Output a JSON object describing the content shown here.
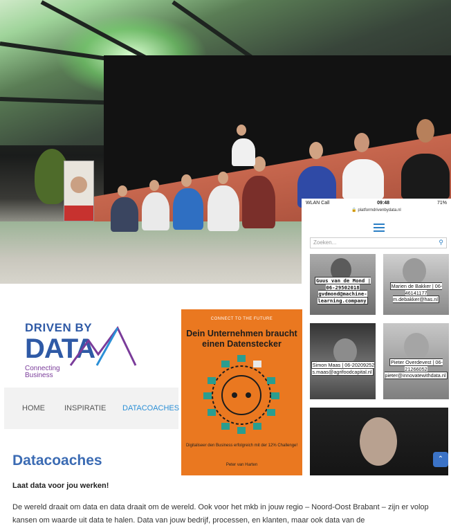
{
  "phone": {
    "carrier": "WLAN Call",
    "time": "09:48",
    "battery": "71%",
    "url": "platformdrivenbydata.nl",
    "search_placeholder": "Zoeken...",
    "coaches": [
      {
        "caption": "Guus van de Mond | 06-29502018 gvdmond@machine-learning.company"
      },
      {
        "caption": "Marien de Bakker | 06-46141177 m.debakker@has.nl"
      },
      {
        "caption": "Simon Maas | 06-20209252 s.maas@agrifoodcapital.nl"
      },
      {
        "caption": "Pieter Overdevest | 06-21266052 pieter@innovatewithdata.nl"
      }
    ]
  },
  "logo": {
    "line1": "DRIVEN BY",
    "line2": "DATA",
    "line3a": "Connecting",
    "line3b": "Business"
  },
  "nav": {
    "home": "HOME",
    "inspiratie": "INSPIRATIE",
    "datacoaches": "DATACOACHES"
  },
  "book": {
    "kicker": "CONNECT TO THE FUTURE",
    "title": "Dein Unternehmen braucht einen Datenstecker",
    "tagline": "Digitaliseer den Business erfolgreich mit der 12% Challenge!",
    "author": "Peter van Harten"
  },
  "page": {
    "title": "Datacoaches",
    "subtitle": "Laat data voor jou werken!",
    "body": "De wereld draait om data en data draait om de wereld. Ook voor het mkb in jouw regio – Noord-Oost Brabant – zijn er volop kansen om waarde uit data te halen. Data van jouw bedrijf, processen, en klanten, maar ook data van de"
  },
  "colors": {
    "brand_blue": "#2f5aa6",
    "link_blue": "#2b8fd6",
    "book_orange": "#ea7820"
  }
}
